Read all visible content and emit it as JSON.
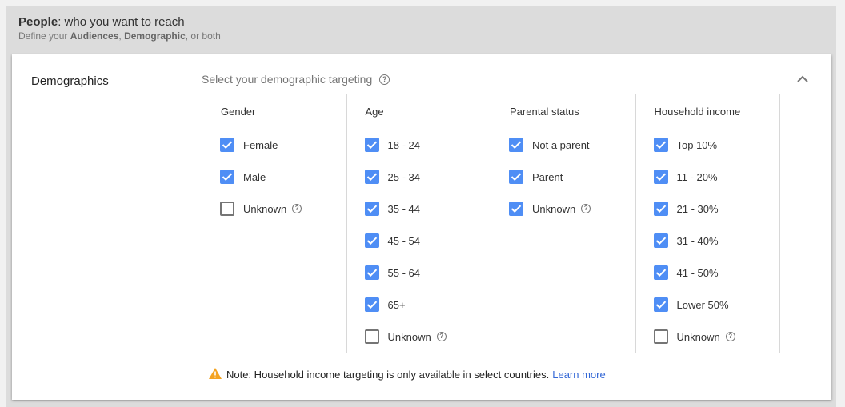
{
  "header": {
    "title_bold": "People",
    "title_rest": ": who you want to reach",
    "subtitle_prefix": "Define your ",
    "subtitle_bold1": "Audiences",
    "subtitle_sep": ", ",
    "subtitle_bold2": "Demographic",
    "subtitle_suffix": ", or both"
  },
  "card": {
    "section_label": "Demographics",
    "select_label": "Select your demographic targeting",
    "help_icon": "?",
    "collapse_icon": "chevron-up-icon"
  },
  "columns": [
    {
      "title": "Gender",
      "options": [
        {
          "label": "Female",
          "checked": true,
          "help": false
        },
        {
          "label": "Male",
          "checked": true,
          "help": false
        },
        {
          "label": "Unknown",
          "checked": false,
          "help": true
        }
      ]
    },
    {
      "title": "Age",
      "options": [
        {
          "label": "18 - 24",
          "checked": true,
          "help": false
        },
        {
          "label": "25 - 34",
          "checked": true,
          "help": false
        },
        {
          "label": "35 - 44",
          "checked": true,
          "help": false
        },
        {
          "label": "45 - 54",
          "checked": true,
          "help": false
        },
        {
          "label": "55 - 64",
          "checked": true,
          "help": false
        },
        {
          "label": "65+",
          "checked": true,
          "help": false
        },
        {
          "label": "Unknown",
          "checked": false,
          "help": true
        }
      ]
    },
    {
      "title": "Parental status",
      "options": [
        {
          "label": "Not a parent",
          "checked": true,
          "help": false
        },
        {
          "label": "Parent",
          "checked": true,
          "help": false
        },
        {
          "label": "Unknown",
          "checked": true,
          "help": true
        }
      ]
    },
    {
      "title": "Household income",
      "options": [
        {
          "label": "Top 10%",
          "checked": true,
          "help": false
        },
        {
          "label": "11 - 20%",
          "checked": true,
          "help": false
        },
        {
          "label": "21 - 30%",
          "checked": true,
          "help": false
        },
        {
          "label": "31 - 40%",
          "checked": true,
          "help": false
        },
        {
          "label": "41 - 50%",
          "checked": true,
          "help": false
        },
        {
          "label": "Lower 50%",
          "checked": true,
          "help": false
        },
        {
          "label": "Unknown",
          "checked": false,
          "help": true
        }
      ]
    }
  ],
  "note": {
    "text": "Note: Household income targeting is only available in select countries.",
    "link": "Learn more"
  },
  "colors": {
    "checkbox_on": "#4f8ef5",
    "warning": "#f4a321",
    "link": "#3367d6"
  }
}
